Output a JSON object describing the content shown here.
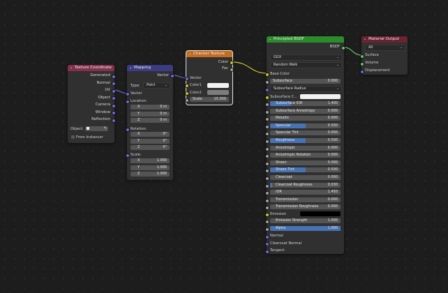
{
  "colors": {
    "tex_coord_header": "#83314a",
    "mapping_header": "#3c3c83",
    "checker_header": "#c46d20",
    "bsdf_header": "#2c8c2c",
    "output_header": "#6b2333",
    "vector_socket": "#6b6bd6",
    "color_socket": "#c7c729",
    "float_socket": "#a1a1a1",
    "shader_socket": "#63c763",
    "accent_blue": "#4772b3"
  },
  "texture_coordinate": {
    "title": "Texture Coordinate",
    "outputs": [
      "Generated",
      "Normal",
      "UV",
      "Object",
      "Camera",
      "Window",
      "Reflection"
    ],
    "object_label": "Object:",
    "from_instancer": "From Instancer"
  },
  "mapping": {
    "title": "Mapping",
    "output_vector": "Vector",
    "type_label": "Type:",
    "type_value": "Point",
    "input_vector": "Vector",
    "location_label": "Location:",
    "location": [
      {
        "axis": "X",
        "value": "0 m"
      },
      {
        "axis": "Y",
        "value": "0 m"
      },
      {
        "axis": "Z",
        "value": "0 m"
      }
    ],
    "rotation_label": "Rotation:",
    "rotation": [
      {
        "axis": "X",
        "value": "0°"
      },
      {
        "axis": "Y",
        "value": "0°"
      },
      {
        "axis": "Z",
        "value": "0°"
      }
    ],
    "scale_label": "Scale:",
    "scale": [
      {
        "axis": "X",
        "value": "1.000"
      },
      {
        "axis": "Y",
        "value": "1.000"
      },
      {
        "axis": "Z",
        "value": "1.000"
      }
    ]
  },
  "checker": {
    "title": "Checker Texture",
    "out_color": "Color",
    "out_fac": "Fac",
    "in_vector": "Vector",
    "color1_label": "Color1",
    "color1_swatch": "#f2f2f2",
    "color2_label": "Color2",
    "color2_swatch": "#7d7d7d",
    "scale_label": "Scale",
    "scale_value": "15.000"
  },
  "bsdf": {
    "title": "Principled BSDF",
    "out_label": "BSDF",
    "distribution": "GGX",
    "subsurface_method": "Random Walk",
    "base_color_label": "Base Color",
    "subsurface": {
      "label": "Subsurface",
      "value": "0.000"
    },
    "subsurface_radius": "Subsurface Radius",
    "subsurface_color": "Subsurface C...",
    "subsurface_color_swatch": "#f2f2f2",
    "rows": [
      {
        "label": "Subsurface IOR",
        "value": "1.400",
        "fill": 0.3
      },
      {
        "label": "Subsurface Anisotropy",
        "value": "0.000",
        "fill": 0
      },
      {
        "label": "Metallic",
        "value": "0.000",
        "fill": 0
      },
      {
        "label": "Specular",
        "value": "0.500",
        "fill": 0.5
      },
      {
        "label": "Specular Tint",
        "value": "0.000",
        "fill": 0
      },
      {
        "label": "Roughness",
        "value": "0.500",
        "fill": 0.5
      },
      {
        "label": "Anisotropic",
        "value": "0.000",
        "fill": 0
      },
      {
        "label": "Anisotropic Rotation",
        "value": "0.000",
        "fill": 0
      },
      {
        "label": "Sheen",
        "value": "0.000",
        "fill": 0
      },
      {
        "label": "Sheen Tint",
        "value": "0.500",
        "fill": 0.5
      },
      {
        "label": "Clearcoat",
        "value": "0.000",
        "fill": 0
      },
      {
        "label": "Clearcoat Roughness",
        "value": "0.030",
        "fill": 0.03
      },
      {
        "label": "IOR",
        "value": "1.450",
        "fill": 0
      },
      {
        "label": "Transmission",
        "value": "0.000",
        "fill": 0
      },
      {
        "label": "Transmission Roughness",
        "value": "0.000",
        "fill": 0
      }
    ],
    "emission_label": "Emission",
    "emission_swatch": "#000000",
    "emission_strength": {
      "label": "Emission Strength",
      "value": "1.000"
    },
    "alpha": {
      "label": "Alpha",
      "value": "1.000",
      "fill": 1
    },
    "normal": "Normal",
    "clearcoat_normal": "Clearcoat Normal",
    "tangent": "Tangent"
  },
  "output": {
    "title": "Material Output",
    "target": "All",
    "inputs": [
      "Surface",
      "Volume",
      "Displacement"
    ]
  }
}
